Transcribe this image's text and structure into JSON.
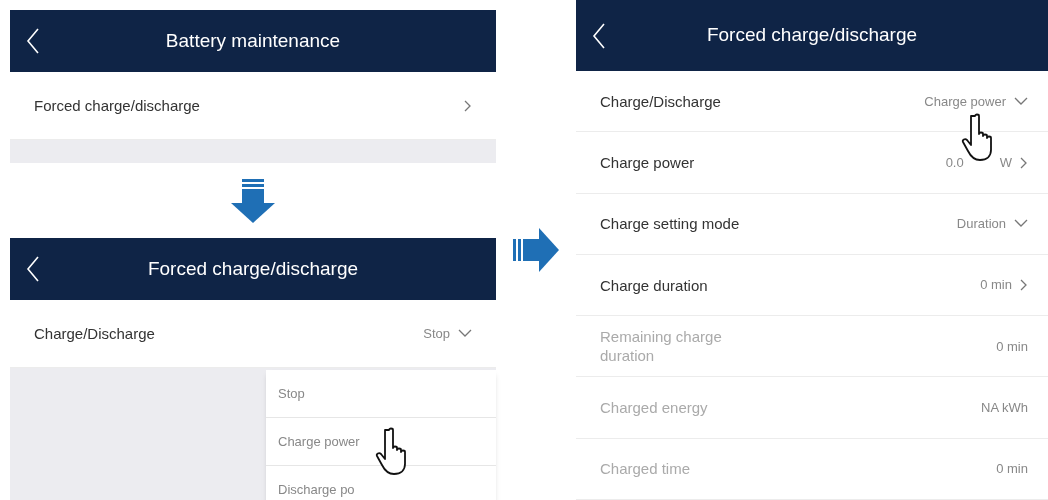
{
  "screens": [
    {
      "title": "Battery maintenance",
      "rows": [
        {
          "label": "Forced charge/discharge",
          "kind": "link",
          "disabled": false
        }
      ]
    },
    {
      "title": "Forced charge/discharge",
      "rows": [
        {
          "label": "Charge/Discharge",
          "value": "Stop",
          "kind": "dropdown",
          "disabled": false
        }
      ],
      "menu": {
        "items": [
          {
            "label": "Stop"
          },
          {
            "label": "Charge power"
          },
          {
            "label": "Discharge po"
          }
        ]
      }
    },
    {
      "title": "Forced charge/discharge",
      "rows": [
        {
          "label": "Charge/Discharge",
          "value": "Charge power",
          "kind": "dropdown",
          "disabled": false
        },
        {
          "label": "Charge power",
          "value": "0.0",
          "value_end": "W",
          "kind": "link",
          "disabled": false
        },
        {
          "label": "Charge setting mode",
          "value": "Duration",
          "kind": "dropdown",
          "disabled": false
        },
        {
          "label": "Charge duration",
          "value": "0 min",
          "kind": "link",
          "disabled": false
        },
        {
          "label": "Remaining charge duration",
          "value": "0 min",
          "kind": "readonly",
          "disabled": true
        },
        {
          "label": "Charged energy",
          "value": "NA kWh",
          "kind": "readonly",
          "disabled": true
        },
        {
          "label": "Charged time",
          "value": "0 min",
          "kind": "readonly",
          "disabled": true
        }
      ]
    }
  ]
}
